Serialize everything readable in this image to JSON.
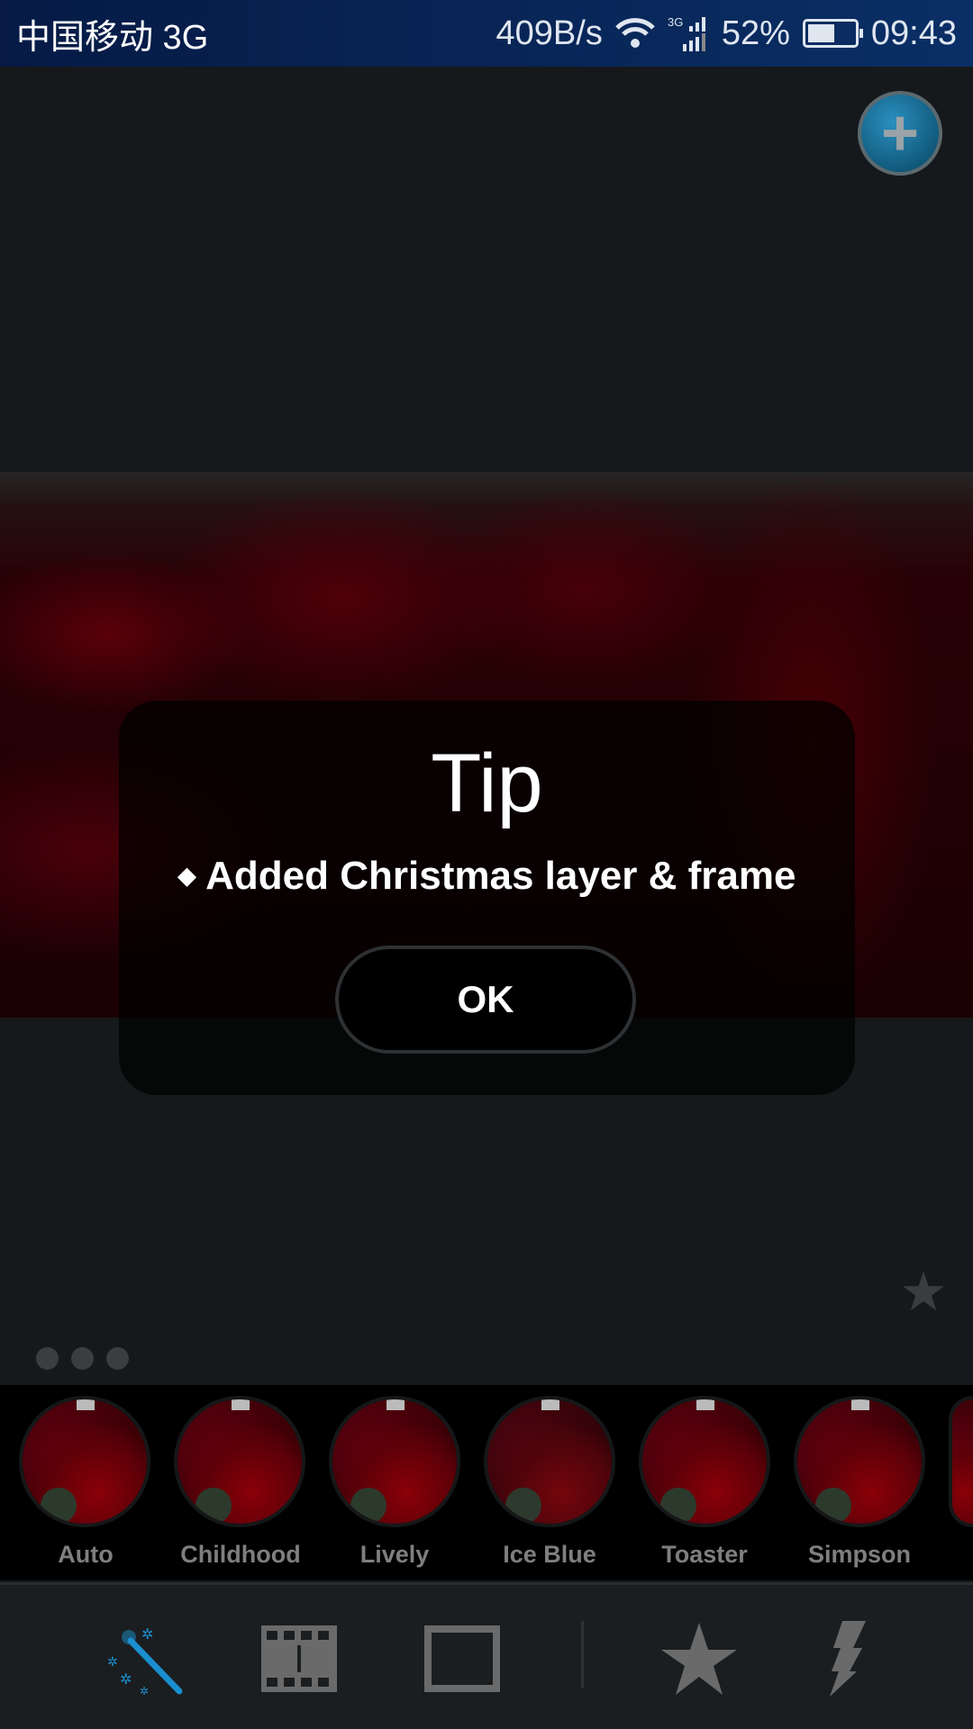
{
  "status_bar": {
    "carrier": "中国移动 3G",
    "speed": "409B/s",
    "network": "3G",
    "battery": "52%",
    "battery_level": 0.52,
    "time": "09:43"
  },
  "dialog": {
    "title": "Tip",
    "bullet": "◆",
    "message": "Added Christmas layer & frame",
    "ok_label": "OK"
  },
  "filters": [
    {
      "label": "Auto"
    },
    {
      "label": "Childhood"
    },
    {
      "label": "Lively"
    },
    {
      "label": "Ice Blue"
    },
    {
      "label": "Toaster"
    },
    {
      "label": "Simpson"
    }
  ],
  "toolbar": [
    {
      "icon": "magic-wand-icon",
      "active": true
    },
    {
      "icon": "film-strip-icon"
    },
    {
      "icon": "frame-icon"
    },
    {
      "icon": "star-icon"
    },
    {
      "icon": "lightning-icon"
    }
  ],
  "colors": {
    "accent": "#1a8fd0",
    "status_bar": "#0a2f66"
  }
}
